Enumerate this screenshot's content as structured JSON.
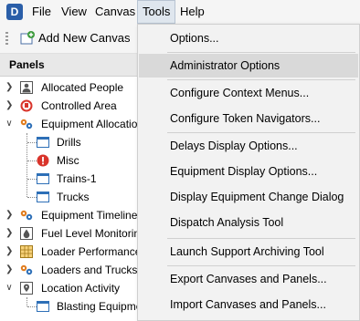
{
  "app": {
    "icon_letter": "D"
  },
  "menubar": {
    "file": "File",
    "view": "View",
    "canvas": "Canvas",
    "tools": "Tools",
    "help": "Help"
  },
  "toolbar": {
    "add_canvas": "Add New Canvas"
  },
  "panels": {
    "header": "Panels",
    "items": [
      {
        "label": "Allocated People"
      },
      {
        "label": "Controlled Area"
      },
      {
        "label": "Equipment Allocation"
      },
      {
        "label": "Drills"
      },
      {
        "label": "Misc"
      },
      {
        "label": "Trains-1"
      },
      {
        "label": "Trucks"
      },
      {
        "label": "Equipment Timeline"
      },
      {
        "label": "Fuel Level Monitoring"
      },
      {
        "label": "Loader Performance"
      },
      {
        "label": "Loaders and Trucks"
      },
      {
        "label": "Location Activity"
      },
      {
        "label": "Blasting Equipment"
      }
    ]
  },
  "tools_menu": {
    "items": [
      {
        "label": "Options..."
      },
      {
        "label": "Administrator Options"
      },
      {
        "label": "Configure Context Menus..."
      },
      {
        "label": "Configure Token Navigators..."
      },
      {
        "label": "Delays Display Options..."
      },
      {
        "label": "Equipment Display Options..."
      },
      {
        "label": "Display Equipment Change Dialog"
      },
      {
        "label": "Dispatch Analysis Tool"
      },
      {
        "label": "Launch Support Archiving Tool"
      },
      {
        "label": "Export Canvases and Panels..."
      },
      {
        "label": "Import Canvases and Panels..."
      }
    ]
  }
}
